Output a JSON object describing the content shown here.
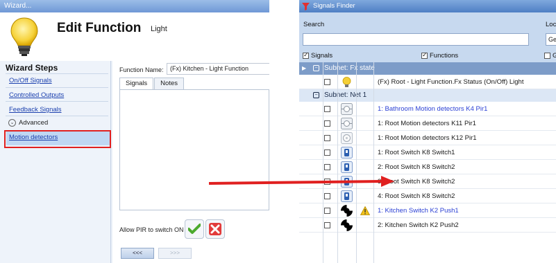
{
  "wizard": {
    "title": "Wizard...",
    "heading": "Edit Function",
    "subtitle": "Light",
    "steps_title": "Wizard Steps",
    "steps": [
      "On/Off Signals",
      "Controlled Outputs",
      "Feedback Signals"
    ],
    "advanced_label": "Advanced",
    "active_step": "Motion detectors",
    "function_name_label": "Function Name:",
    "function_name_value": "(Fx) Kitchen - Light Function",
    "tabs": [
      "Signals",
      "Notes"
    ],
    "allow_pir_label": "Allow PIR to switch ON",
    "back_button": "<<<",
    "next_button": ">>>"
  },
  "signals_finder": {
    "title": "Signals Finder",
    "search_label": "Search",
    "location_label": "Loc",
    "location_value": "Ge",
    "search_value": "",
    "checkboxes": [
      {
        "label": "Signals",
        "checked": true
      },
      {
        "label": "Functions",
        "checked": true
      },
      {
        "label": "Gr",
        "checked": false
      }
    ],
    "subnet_fx": "Subnet: Fx state",
    "fx_row": "(Fx) Root - Light Function.Fx Status (On/Off) Light",
    "subnet_net": "Subnet: Net 1",
    "rows": [
      {
        "text": "1: Bathroom Motion detectors K4 Pir1",
        "icon": "motion-sensor-icon",
        "highlight": true,
        "warning": false
      },
      {
        "text": "1: Root Motion detectors K11 Pir1",
        "icon": "motion-sensor-icon",
        "highlight": false,
        "warning": false
      },
      {
        "text": "1: Root Motion detectors K12 Pir1",
        "icon": "ceiling-sensor-icon",
        "highlight": false,
        "warning": false
      },
      {
        "text": "1: Root Switch K8 Switch1",
        "icon": "switch-icon",
        "highlight": false,
        "warning": false
      },
      {
        "text": "2: Root Switch K8 Switch2",
        "icon": "switch-icon",
        "highlight": false,
        "warning": false
      },
      {
        "text": "3: Root Switch K8 Switch2",
        "icon": "switch-icon",
        "highlight": false,
        "warning": false
      },
      {
        "text": "4: Root Switch K8 Switch2",
        "icon": "switch-icon",
        "highlight": false,
        "warning": false
      },
      {
        "text": "1: Kitchen Switch K2 Push1",
        "icon": "push-button-icon",
        "highlight": true,
        "warning": true
      },
      {
        "text": "2: Kitchen Switch K2 Push2",
        "icon": "push-button-icon",
        "highlight": false,
        "warning": false
      }
    ]
  },
  "colors": {
    "link": "#1a3fae",
    "highlight_text": "#2a3fd4",
    "callout_red": "#e02020"
  }
}
